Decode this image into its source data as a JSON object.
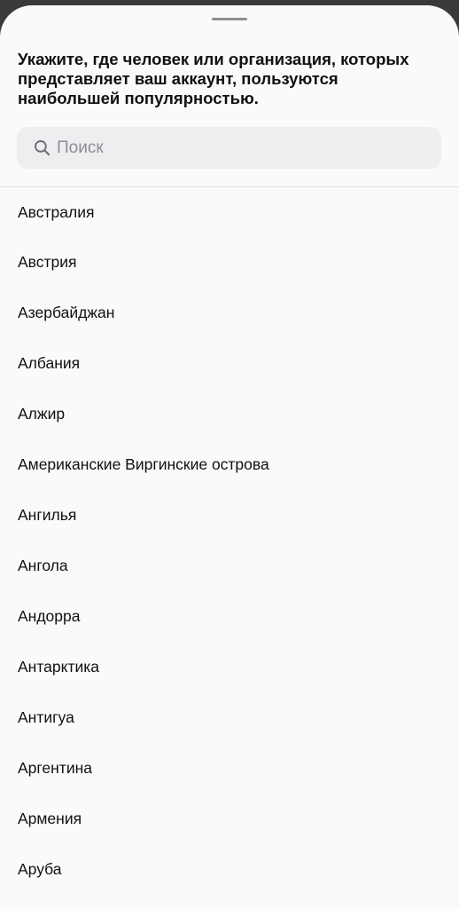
{
  "sheet": {
    "title": "Укажите, где человек или организация, которых представляет ваш аккаунт, пользуются наибольшей популярностью."
  },
  "search": {
    "placeholder": "Поиск",
    "value": "",
    "icon": "search-icon"
  },
  "countries": [
    "Австралия",
    "Австрия",
    "Азербайджан",
    "Албания",
    "Алжир",
    "Американские Виргинские острова",
    "Ангилья",
    "Ангола",
    "Андорра",
    "Антарктика",
    "Антигуа",
    "Аргентина",
    "Армения",
    "Аруба"
  ],
  "colors": {
    "sheet_background": "#fafafa",
    "search_background": "#eceef0",
    "text": "#111111",
    "placeholder": "#8e8e93",
    "backdrop": "#3a3a3c"
  }
}
